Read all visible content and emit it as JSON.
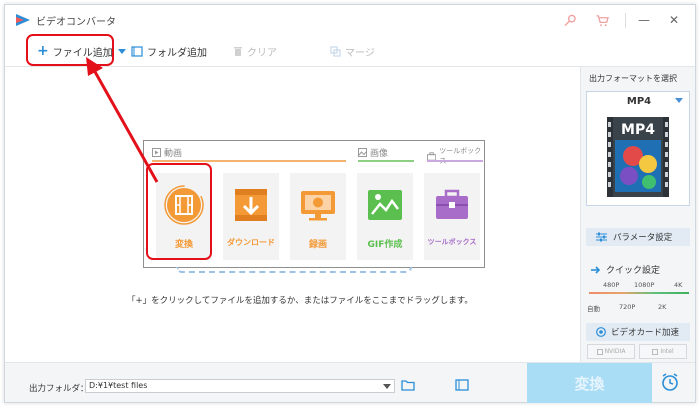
{
  "app": {
    "title": "ビデオコンバータ"
  },
  "toolbar": {
    "add_file": "ファイル追加",
    "add_folder": "フォルダ追加",
    "clear": "クリア",
    "merge": "マージ"
  },
  "home": {
    "groups": {
      "video": "動画",
      "image": "画像",
      "toolbox": "ツールボックス"
    },
    "tiles": [
      {
        "label": "変換",
        "icon": "film-convert-icon"
      },
      {
        "label": "ダウンロード",
        "icon": "download-icon"
      },
      {
        "label": "録画",
        "icon": "screen-record-icon"
      },
      {
        "label": "GIF作成",
        "icon": "gif-image-icon"
      },
      {
        "label": "ツールボックス",
        "icon": "toolbox-icon"
      }
    ],
    "hint": "「+」をクリックしてファイルを追加するか、またはファイルをここまでドラッグします。"
  },
  "output_panel": {
    "title": "出力フォーマットを選択",
    "format": "MP4",
    "param_button": "パラメータ設定",
    "quick_title": "クイック設定",
    "quality_top": [
      "480P",
      "1080P",
      "4K"
    ],
    "quality_bottom": [
      "自動",
      "720P",
      "2K"
    ],
    "gpu_button": "ビデオカード加速",
    "gpu_nvidia": "NVIDIA",
    "gpu_intel": "Intel"
  },
  "bottom": {
    "folder_label": "出力フォルダ：",
    "folder_path": "D:¥1¥test files",
    "convert": "変換"
  },
  "colors": {
    "accent_blue": "#4a90d9",
    "convert_disabled": "#a9dcf5",
    "highlight_red": "#e3101a",
    "video_orange": "#f39a37",
    "gif_green": "#5bbf4f",
    "toolbox_purple": "#a86cc9"
  }
}
